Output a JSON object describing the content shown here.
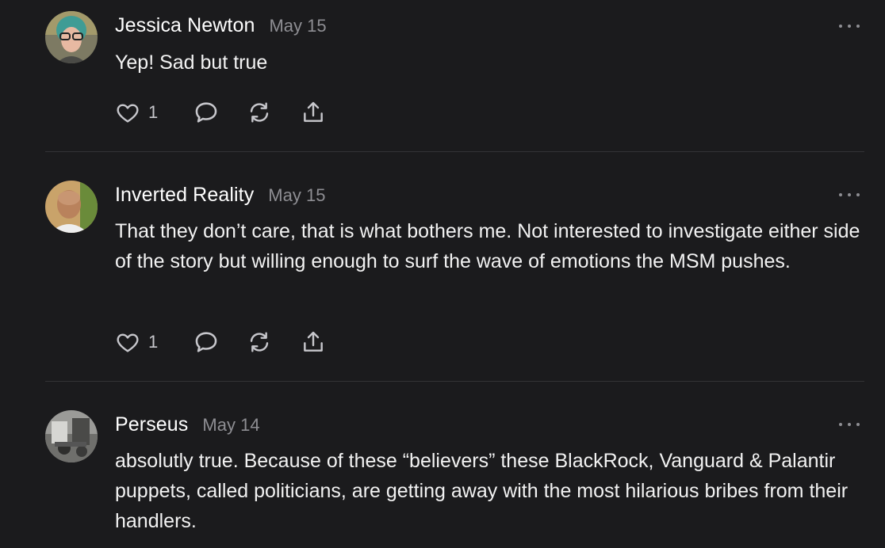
{
  "comments": [
    {
      "author": "Jessica Newton",
      "date": "May 15",
      "text": "Yep! Sad but true",
      "likes": "1"
    },
    {
      "author": "Inverted Reality",
      "date": "May 15",
      "text": "That they don’t care, that is what bothers me. Not interested to investigate either side of the story but willing enough to surf the wave of emotions the MSM pushes.",
      "likes": "1"
    },
    {
      "author": "Perseus",
      "date": "May 14",
      "text": "absolutly true. Because of these “believers” these BlackRock, Vanguard & Palantir puppets, called politicians, are getting away with the most hilarious bribes from their handlers."
    }
  ],
  "icons": {
    "like": "heart-icon",
    "reply": "speech-bubble-icon",
    "restack": "restack-arrows-icon",
    "share": "share-upload-icon",
    "more": "ellipsis-icon"
  },
  "colors": {
    "background": "#1b1b1d",
    "text": "#f2f2f2",
    "muted": "#8e8e93",
    "icon": "#c7c7cc",
    "divider": "#333336"
  }
}
